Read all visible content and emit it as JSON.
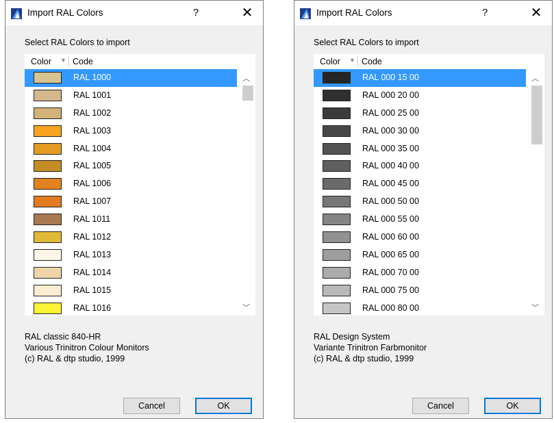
{
  "dialogs": [
    {
      "title": "Import RAL Colors",
      "help_label": "?",
      "close_label": "✕",
      "prompt": "Select RAL Colors to import",
      "header": {
        "color": "Color",
        "code": "Code"
      },
      "rows": [
        {
          "code": "RAL 1000",
          "color": "#d7c48f",
          "selected": true
        },
        {
          "code": "RAL 1001",
          "color": "#d4b88e"
        },
        {
          "code": "RAL 1002",
          "color": "#d3b278"
        },
        {
          "code": "RAL 1003",
          "color": "#f6a422"
        },
        {
          "code": "RAL 1004",
          "color": "#e69b25"
        },
        {
          "code": "RAL 1005",
          "color": "#c48d26"
        },
        {
          "code": "RAL 1006",
          "color": "#e08320"
        },
        {
          "code": "RAL 1007",
          "color": "#e37c20"
        },
        {
          "code": "RAL 1011",
          "color": "#a97a4f"
        },
        {
          "code": "RAL 1012",
          "color": "#e0b939"
        },
        {
          "code": "RAL 1013",
          "color": "#fdf6e6"
        },
        {
          "code": "RAL 1014",
          "color": "#eed4a8"
        },
        {
          "code": "RAL 1015",
          "color": "#fcecd1"
        },
        {
          "code": "RAL 1016",
          "color": "#fbf437"
        }
      ],
      "info": [
        "RAL classic 840-HR",
        "Various Trinitron Colour Monitors",
        "(c) RAL & dtp studio, 1999"
      ],
      "cancel_label": "Cancel",
      "ok_label": "OK"
    },
    {
      "title": "Import RAL Colors",
      "help_label": "?",
      "close_label": "✕",
      "prompt": "Select RAL Colors to import",
      "header": {
        "color": "Color",
        "code": "Code"
      },
      "rows": [
        {
          "code": "RAL 000 15 00",
          "color": "#262626",
          "selected": true
        },
        {
          "code": "RAL 000 20 00",
          "color": "#303030"
        },
        {
          "code": "RAL 000 25 00",
          "color": "#3b3b3b"
        },
        {
          "code": "RAL 000 30 00",
          "color": "#474747"
        },
        {
          "code": "RAL 000 35 00",
          "color": "#535353"
        },
        {
          "code": "RAL 000 40 00",
          "color": "#5f5f5f"
        },
        {
          "code": "RAL 000 45 00",
          "color": "#6b6b6b"
        },
        {
          "code": "RAL 000 50 00",
          "color": "#777777"
        },
        {
          "code": "RAL 000 55 00",
          "color": "#848484"
        },
        {
          "code": "RAL 000 60 00",
          "color": "#919191"
        },
        {
          "code": "RAL 000 65 00",
          "color": "#9e9e9e"
        },
        {
          "code": "RAL 000 70 00",
          "color": "#ababab"
        },
        {
          "code": "RAL 000 75 00",
          "color": "#b9b9b9"
        },
        {
          "code": "RAL 000 80 00",
          "color": "#c6c6c6"
        }
      ],
      "info": [
        "RAL Design System",
        "Variante Trinitron Farbmonitor",
        "(c) RAL & dtp studio, 1999"
      ],
      "cancel_label": "Cancel",
      "ok_label": "OK"
    }
  ],
  "icons": {
    "app": "archicad-icon",
    "sort": "sort-descending-icon",
    "scroll_up": "chevron-up-icon",
    "scroll_down": "chevron-down-icon"
  },
  "colors": {
    "selection": "#3399ff",
    "dialog_bg": "#f0f0f0",
    "ok_border": "#0078d7"
  }
}
